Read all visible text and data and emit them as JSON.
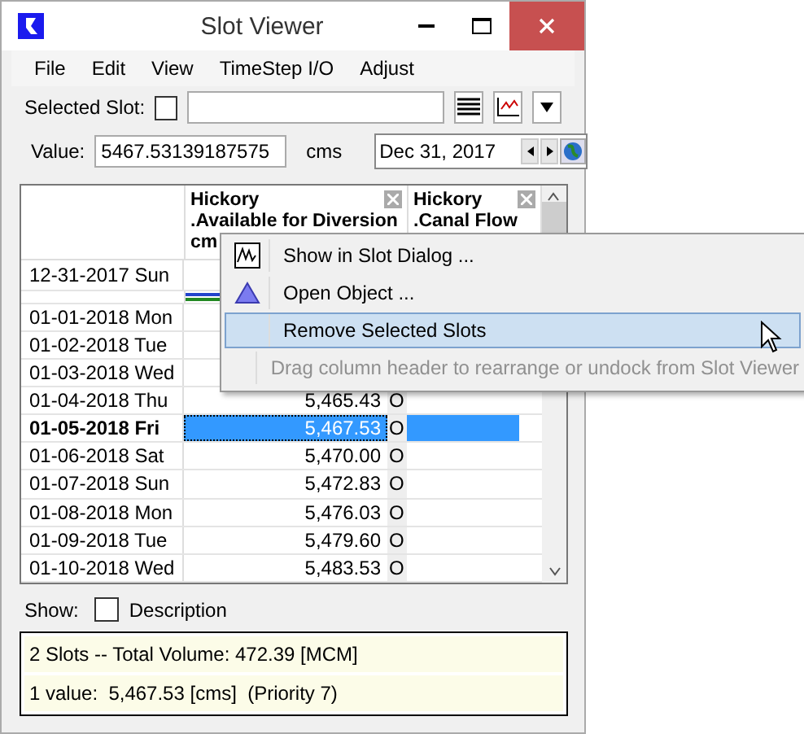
{
  "window": {
    "title": "Slot Viewer"
  },
  "menu": [
    "File",
    "Edit",
    "View",
    "TimeStep I/O",
    "Adjust"
  ],
  "selected_slot": {
    "label": "Selected Slot:",
    "checked": false
  },
  "value": {
    "label": "Value:",
    "value": "5467.53139187575",
    "unit": "cms",
    "date": "Dec 31, 2017"
  },
  "table": {
    "columns": [
      {
        "title": "Hickory",
        "subtitle": ".Available for Diversion",
        "unit": "cm"
      },
      {
        "title": "Hickory",
        "subtitle": ".Canal Flow"
      }
    ],
    "rows": [
      {
        "date": "12-31-2017 Sun",
        "selected": false
      },
      {
        "date": "01-01-2018 Mon",
        "selected": false
      },
      {
        "date": "01-02-2018 Tue",
        "selected": false
      },
      {
        "date": "01-03-2018 Wed",
        "selected": false
      },
      {
        "date": "01-04-2018 Thu",
        "value": "5,465.43",
        "flag": "O",
        "selected": false
      },
      {
        "date": "01-05-2018 Fri",
        "value": "5,467.53",
        "flag": "O",
        "selected": true
      },
      {
        "date": "01-06-2018 Sat",
        "value": "5,470.00",
        "flag": "O",
        "selected": false
      },
      {
        "date": "01-07-2018 Sun",
        "value": "5,472.83",
        "flag": "O",
        "selected": false
      },
      {
        "date": "01-08-2018 Mon",
        "value": "5,476.03",
        "flag": "O",
        "selected": false
      },
      {
        "date": "01-09-2018 Tue",
        "value": "5,479.60",
        "flag": "O",
        "selected": false
      },
      {
        "date": "01-10-2018 Wed",
        "value": "5,483.53",
        "flag": "O",
        "selected": false
      }
    ]
  },
  "context_menu": [
    {
      "label": "Show in Slot Dialog ...",
      "kind": "graph",
      "selected": false,
      "disabled": false
    },
    {
      "label": "Open Object ...",
      "kind": "object",
      "selected": false,
      "disabled": false
    },
    {
      "label": "Remove Selected Slots",
      "kind": "plain",
      "selected": true,
      "disabled": false
    },
    {
      "label": "Drag column header to rearrange or undock from Slot Viewer",
      "kind": "plain",
      "selected": false,
      "disabled": true
    }
  ],
  "show": {
    "label": "Show:",
    "option": "Description",
    "checked": false
  },
  "status": [
    "2 Slots -- Total Volume: 472.39 [MCM]",
    "1 value:  5,467.53 [cms]  (Priority 7)"
  ]
}
